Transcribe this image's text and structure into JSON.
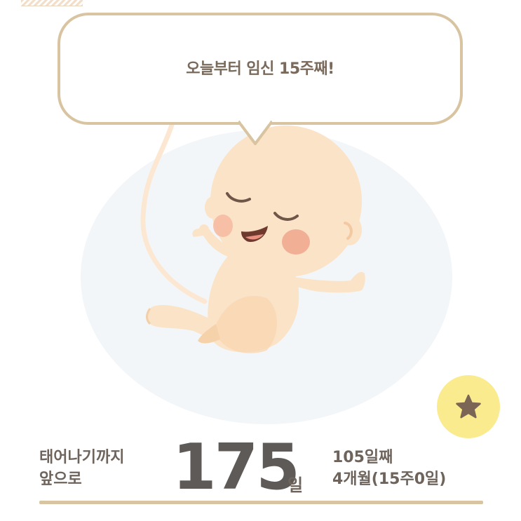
{
  "bubble": {
    "message": "오늘부터 임신 15주째!"
  },
  "summary": {
    "until_birth_line1": "태어나기까지",
    "until_birth_line2": "앞으로",
    "days_remaining": "175",
    "days_unit": "일",
    "elapsed_days": "105일째",
    "months_weeks": "4개월(15주0일)"
  },
  "icons": {
    "favorite": "star-icon",
    "illustration": "fetus-illustration"
  },
  "colors": {
    "accent_border": "#d8c4a0",
    "star_button_bg": "#faeb8e",
    "star_fill": "#7b6655",
    "text": "#6e645c",
    "number": "#5e5a58"
  }
}
